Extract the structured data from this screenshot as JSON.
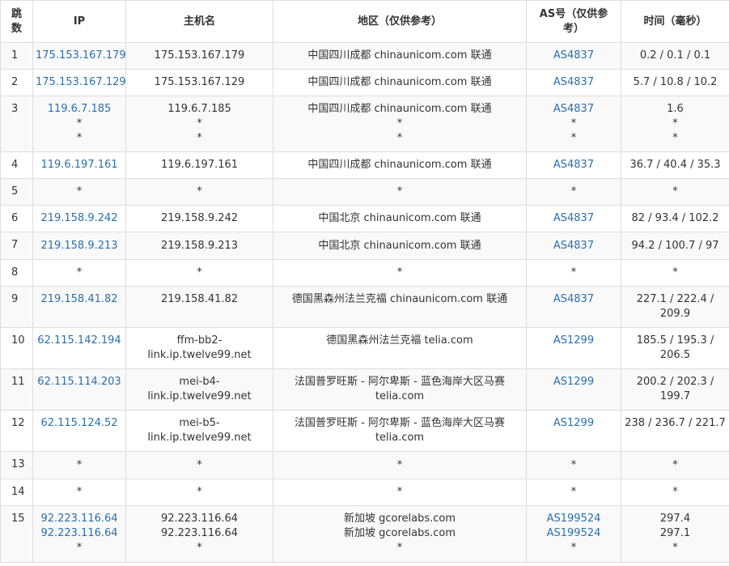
{
  "headers": [
    "跳数",
    "IP",
    "主机名",
    "地区（仅供参考）",
    "AS号（仅供参考）",
    "时间（毫秒）"
  ],
  "rows": [
    {
      "hop": "1",
      "h": 33,
      "ip": [
        "175.153.167.179"
      ],
      "host": [
        "175.153.167.179"
      ],
      "region": [
        "中国四川成都 chinaunicom.com 联通"
      ],
      "asn": [
        "AS4837"
      ],
      "time": [
        "0.2 / 0.1 / 0.1"
      ]
    },
    {
      "hop": "2",
      "h": 33,
      "ip": [
        "175.153.167.129"
      ],
      "host": [
        "175.153.167.129"
      ],
      "region": [
        "中国四川成都 chinaunicom.com 联通"
      ],
      "asn": [
        "AS4837"
      ],
      "time": [
        "5.7 / 10.8 / 10.2"
      ]
    },
    {
      "hop": "3",
      "h": 69,
      "ip": [
        "119.6.7.185",
        "*",
        "*"
      ],
      "host": [
        "119.6.7.185",
        "*",
        "*"
      ],
      "region": [
        "中国四川成都 chinaunicom.com 联通",
        "*",
        "*"
      ],
      "asn": [
        "AS4837",
        "*",
        "*"
      ],
      "time": [
        "1.6",
        "*",
        "*"
      ],
      "multi": true
    },
    {
      "hop": "4",
      "h": 33,
      "ip": [
        "119.6.197.161"
      ],
      "host": [
        "119.6.197.161"
      ],
      "region": [
        "中国四川成都 chinaunicom.com 联通"
      ],
      "asn": [
        "AS4837"
      ],
      "time": [
        "36.7 / 40.4 / 35.3"
      ]
    },
    {
      "hop": "5",
      "h": 33,
      "ip": [
        "*"
      ],
      "host": [
        "*"
      ],
      "region": [
        "*"
      ],
      "asn": [
        "*"
      ],
      "time": [
        "*"
      ]
    },
    {
      "hop": "6",
      "h": 33,
      "ip": [
        "219.158.9.242"
      ],
      "host": [
        "219.158.9.242"
      ],
      "region": [
        "中国北京 chinaunicom.com 联通"
      ],
      "asn": [
        "AS4837"
      ],
      "time": [
        "82 / 93.4 / 102.2"
      ]
    },
    {
      "hop": "7",
      "h": 34,
      "ip": [
        "219.158.9.213"
      ],
      "host": [
        "219.158.9.213"
      ],
      "region": [
        "中国北京 chinaunicom.com 联通"
      ],
      "asn": [
        "AS4837"
      ],
      "time": [
        "94.2 / 100.7 / 97"
      ]
    },
    {
      "hop": "8",
      "h": 33,
      "ip": [
        "*"
      ],
      "host": [
        "*"
      ],
      "region": [
        "*"
      ],
      "asn": [
        "*"
      ],
      "time": [
        "*"
      ]
    },
    {
      "hop": "9",
      "h": 51,
      "ip": [
        "219.158.41.82"
      ],
      "host": [
        "219.158.41.82"
      ],
      "region": [
        "德国黑森州法兰克福 chinaunicom.com 联通"
      ],
      "asn": [
        "AS4837"
      ],
      "time": [
        "227.1 / 222.4 / 209.9"
      ],
      "multi": true
    },
    {
      "hop": "10",
      "h": 51,
      "ip": [
        "62.115.142.194"
      ],
      "host": [
        "ffm-bb2-link.ip.twelve99.net"
      ],
      "region": [
        "德国黑森州法兰克福 telia.com"
      ],
      "asn": [
        "AS1299"
      ],
      "time": [
        "185.5 / 195.3 / 206.5"
      ],
      "multi": true
    },
    {
      "hop": "11",
      "h": 51,
      "ip": [
        "62.115.114.203"
      ],
      "host": [
        "mei-b4-link.ip.twelve99.net"
      ],
      "region": [
        "法国普罗旺斯 - 阿尔卑斯 - 蓝色海岸大区马赛 telia.com"
      ],
      "asn": [
        "AS1299"
      ],
      "time": [
        "200.2 / 202.3 / 199.7"
      ],
      "multi": true
    },
    {
      "hop": "12",
      "h": 51,
      "ip": [
        "62.115.124.52"
      ],
      "host": [
        "mei-b5-link.ip.twelve99.net"
      ],
      "region": [
        "法国普罗旺斯 - 阿尔卑斯 - 蓝色海岸大区马赛 telia.com"
      ],
      "asn": [
        "AS1299"
      ],
      "time": [
        "238 / 236.7 / 221.7"
      ],
      "multi": true
    },
    {
      "hop": "13",
      "h": 34,
      "ip": [
        "*"
      ],
      "host": [
        "*"
      ],
      "region": [
        "*"
      ],
      "asn": [
        "*"
      ],
      "time": [
        "*"
      ]
    },
    {
      "hop": "14",
      "h": 33,
      "ip": [
        "*"
      ],
      "host": [
        "*"
      ],
      "region": [
        "*"
      ],
      "asn": [
        "*"
      ],
      "time": [
        "*"
      ]
    },
    {
      "hop": "15",
      "h": 70,
      "ip": [
        "92.223.116.64",
        "92.223.116.64",
        "*"
      ],
      "host": [
        "92.223.116.64",
        "92.223.116.64",
        "*"
      ],
      "region": [
        "新加坡 gcorelabs.com",
        "新加坡 gcorelabs.com",
        "*"
      ],
      "asn": [
        "AS199524",
        "AS199524",
        "*"
      ],
      "time": [
        "297.4",
        "297.1",
        "*"
      ],
      "multi": true
    }
  ]
}
